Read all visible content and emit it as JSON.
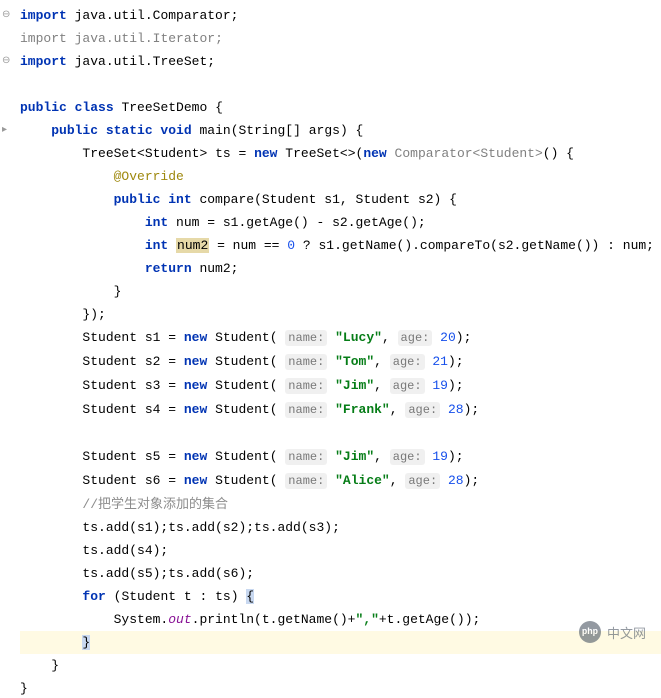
{
  "imports": {
    "i1": "java.util.Comparator",
    "i2": "java.util.Iterator",
    "i3": "java.util.TreeSet"
  },
  "class_decl": {
    "modifiers": "public class",
    "name": "TreeSetDemo"
  },
  "main": {
    "modifiers": "public static void",
    "name": "main",
    "param_type": "String[]",
    "param_name": "args"
  },
  "treeset": {
    "decl_type": "TreeSet",
    "generic": "Student",
    "var": "ts",
    "new_kw": "new",
    "ctor": "TreeSet<>",
    "comp_new": "new",
    "comp_type": "Comparator<Student>"
  },
  "override": "@Override",
  "compare": {
    "modifiers": "public int",
    "name": "compare",
    "p1t": "Student",
    "p1n": "s1",
    "p2t": "Student",
    "p2n": "s2",
    "line1_a": "int",
    "line1_b": "num",
    "line1_c": "s1",
    "line1_d": ".getAge() - ",
    "line1_e": "s2",
    "line1_f": ".getAge();",
    "line2_a": "int",
    "line2_b": "num2",
    "line2_c": " = num == ",
    "line2_d": "0",
    "line2_e": " ? ",
    "line2_f": "s1",
    "line2_g": ".getName().compareTo(",
    "line2_h": "s2",
    "line2_i": ".getName()) : num;",
    "line3_a": "return",
    "line3_b": " num2;"
  },
  "students": {
    "s1": {
      "var": "s1",
      "name": "\"Lucy\"",
      "age": "20"
    },
    "s2": {
      "var": "s2",
      "name": "\"Tom\"",
      "age": "21"
    },
    "s3": {
      "var": "s3",
      "name": "\"Jim\"",
      "age": "19"
    },
    "s4": {
      "var": "s4",
      "name": "\"Frank\"",
      "age": "28"
    },
    "s5": {
      "var": "s5",
      "name": "\"Jim\"",
      "age": "19"
    },
    "s6": {
      "var": "s6",
      "name": "\"Alice\"",
      "age": "28"
    }
  },
  "student_common": {
    "type": "Student",
    "new": "new",
    "ctor": "Student",
    "hint_name": "name:",
    "hint_age": "age:"
  },
  "comment1": "//把学生对象添加的集合",
  "adds": {
    "l1": "ts.add(s1);ts.add(s2);ts.add(s3);",
    "l2": "ts.add(s4);",
    "l3": "ts.add(s5);ts.add(s6);"
  },
  "for": {
    "kw": "for",
    "type": "Student",
    "var": "t",
    "coll": "ts",
    "body_a": "System.",
    "body_b": "out",
    "body_c": ".println(t.getName()+",
    "body_d": "\",\"",
    "body_e": "+t.getAge());"
  },
  "kw": {
    "import": "import",
    "new": "new"
  },
  "watermark": {
    "logo": "php",
    "text": "中文网"
  }
}
